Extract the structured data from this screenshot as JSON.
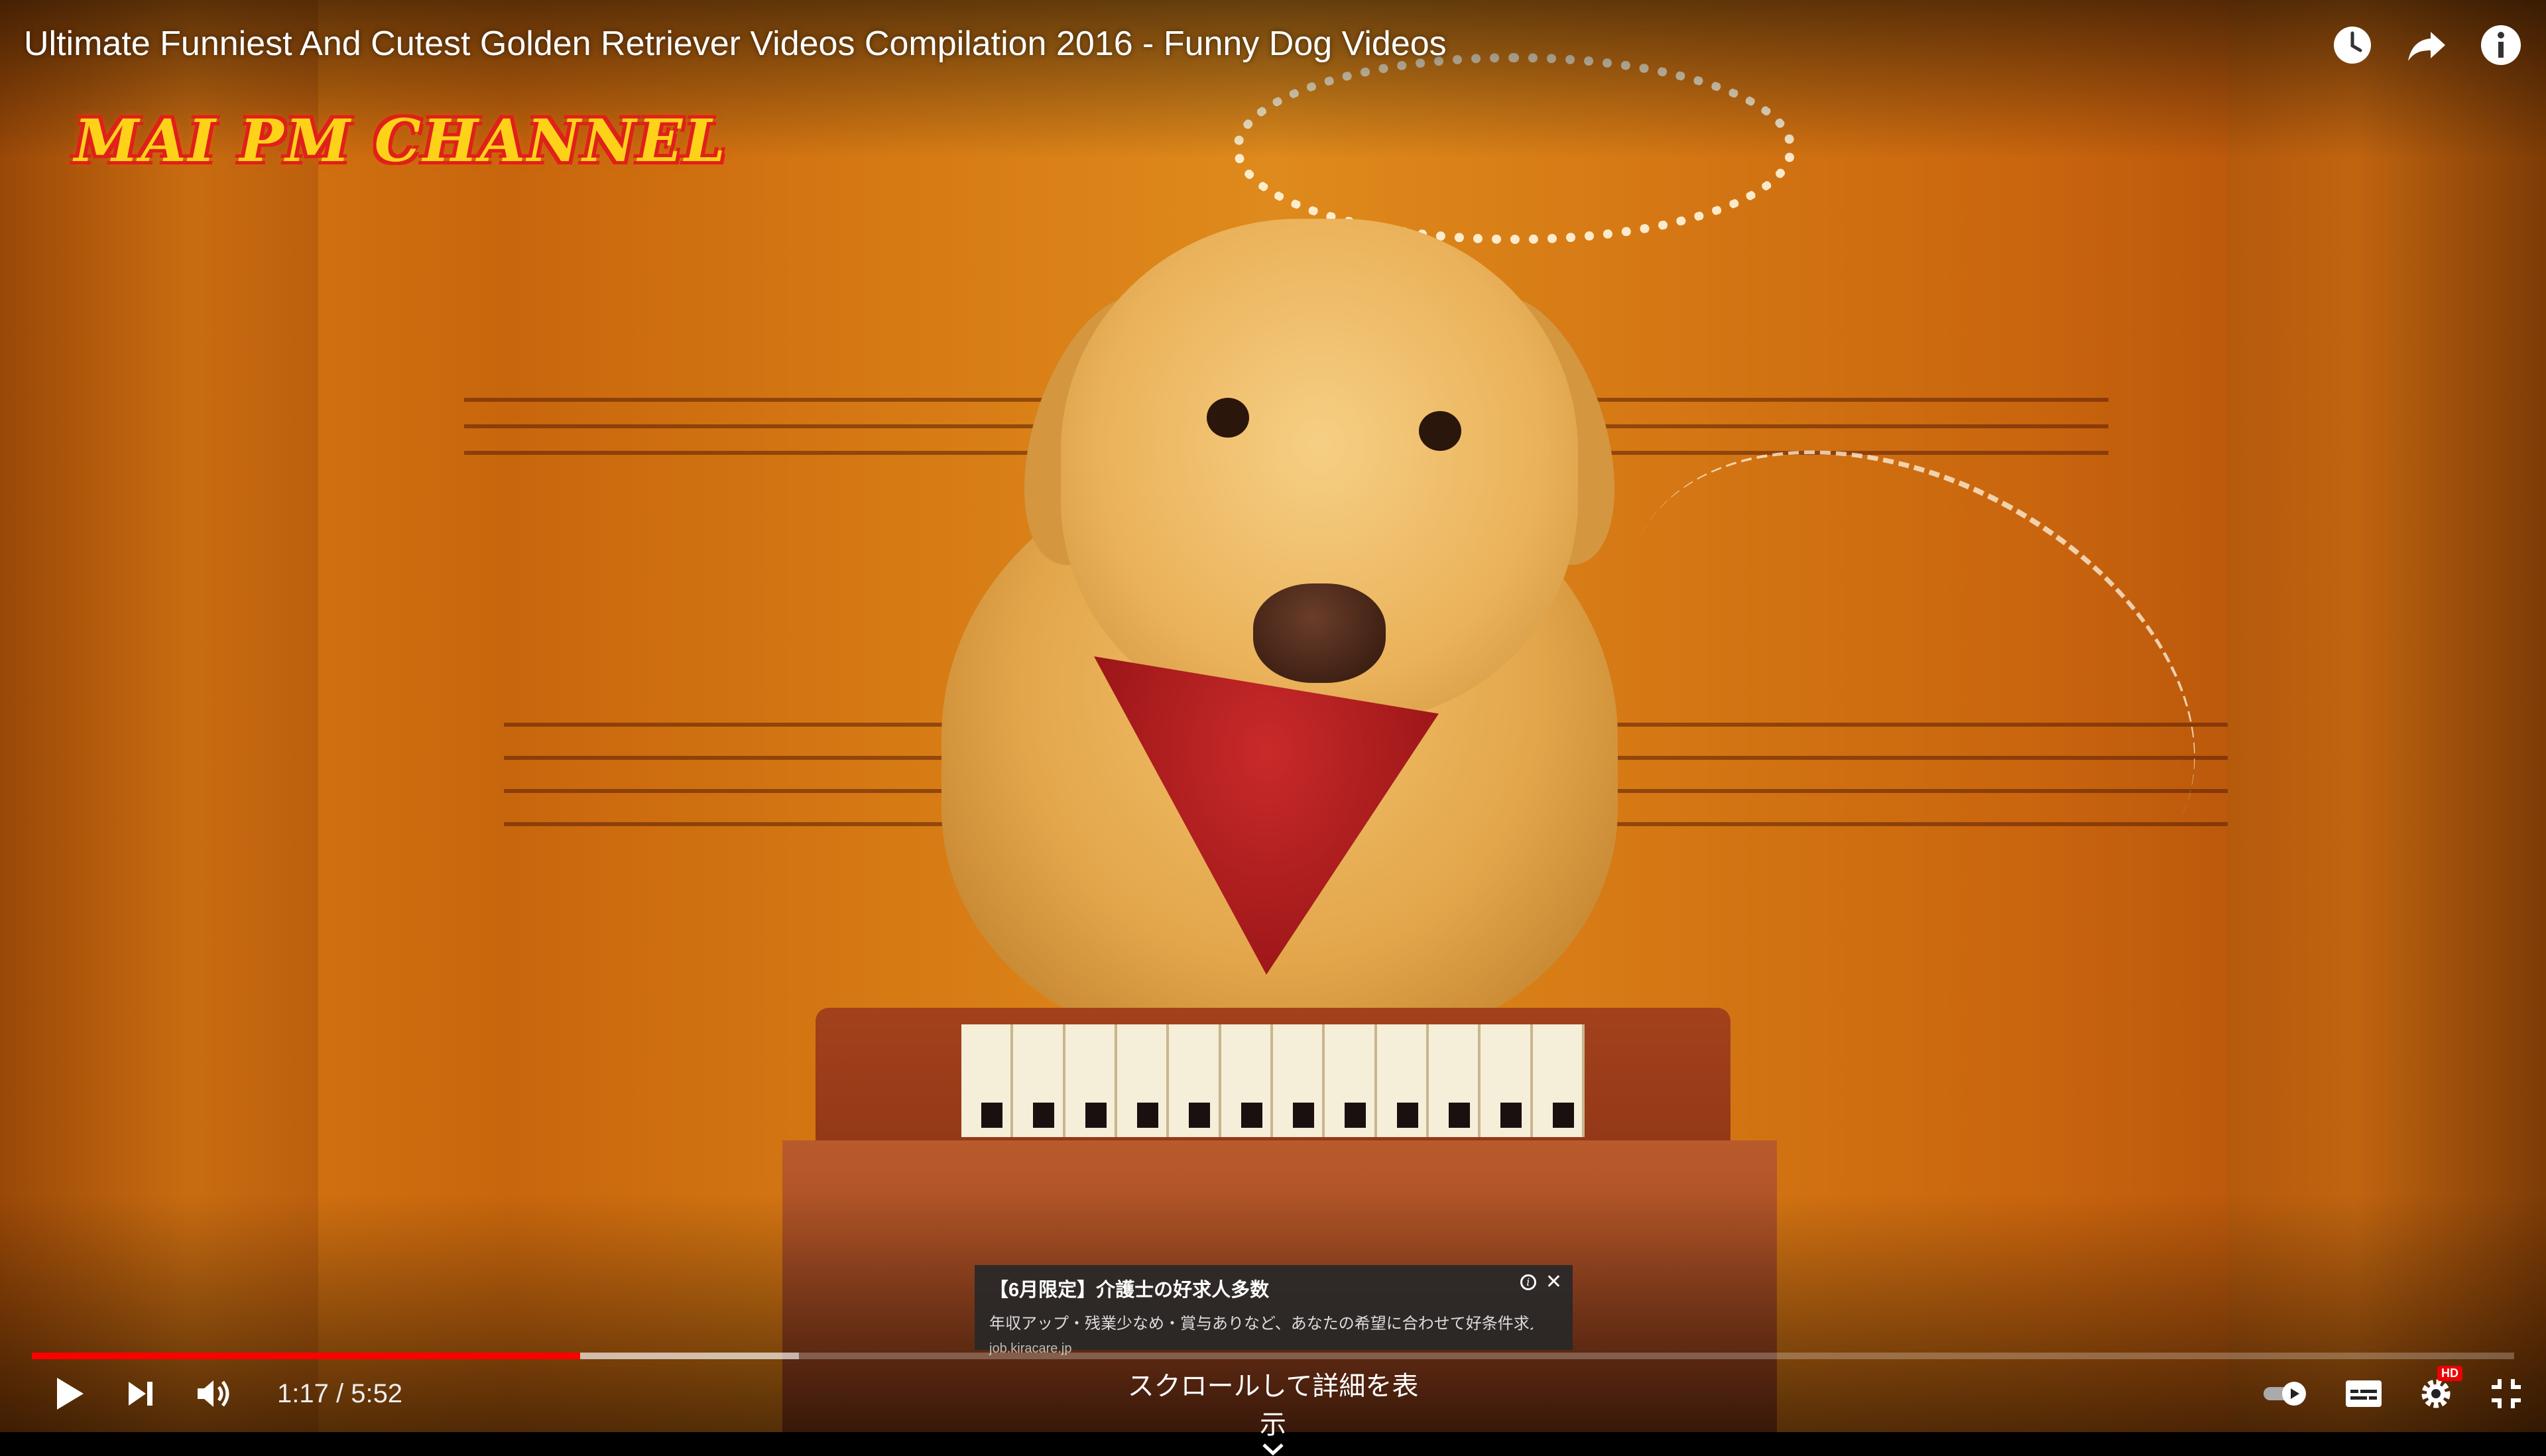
{
  "player": {
    "title": "Ultimate Funniest And Cutest Golden Retriever Videos Compilation 2016 - Funny Dog Videos",
    "watermark": "MAI PM CHANNEL",
    "top_icons": [
      "watch-later-icon",
      "share-icon",
      "info-icon"
    ],
    "progress": {
      "played_fraction": 0.221,
      "buffered_fraction": 0.309
    },
    "time": {
      "current": "1:17",
      "separator": " / ",
      "duration": "5:52"
    },
    "scroll_hint": "スクロールして詳細を表示",
    "right_controls": [
      "autoplay-toggle-icon",
      "subtitles-icon",
      "settings-icon",
      "exit-fullscreen-icon"
    ],
    "hd_badge": "HD",
    "colors": {
      "accent": "#ff0000",
      "ad_bg": "#282828"
    }
  },
  "ad": {
    "title": "【6月限定】介護士の好求人多数",
    "description": "年収アップ・残業少なめ・賞与ありなど、あなたの希望に合わせて好条件求人...",
    "url": "job.kiracare.jp"
  }
}
